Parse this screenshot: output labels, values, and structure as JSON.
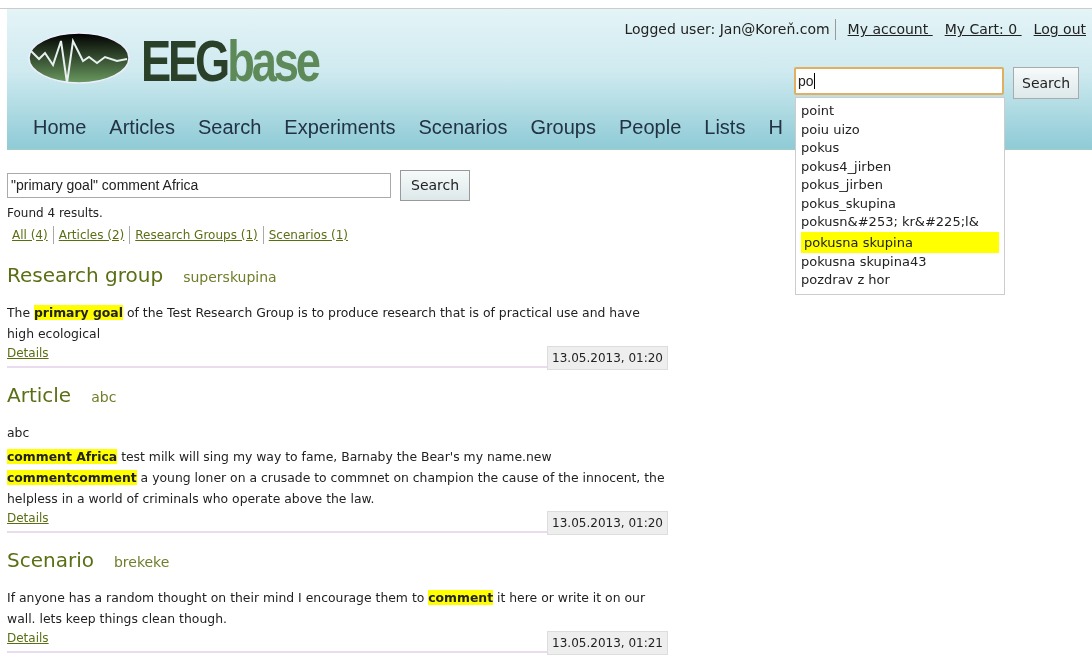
{
  "logo": {
    "dark": "EEG",
    "light": "base"
  },
  "user_bar": {
    "logged_user": "Logged user: Jan@Koreň.com",
    "links": [
      "My account ",
      "My Cart: 0 ",
      "Log out"
    ]
  },
  "header_search": {
    "value": "po",
    "button": "Search",
    "focused": true
  },
  "autocomplete": [
    {
      "label": "point",
      "selected": false
    },
    {
      "label": "poiu uizo",
      "selected": false
    },
    {
      "label": "pokus",
      "selected": false
    },
    {
      "label": "pokus4_jirben",
      "selected": false
    },
    {
      "label": "pokus_jirben",
      "selected": false
    },
    {
      "label": "pokus_skupina",
      "selected": false
    },
    {
      "label": "pokusn&#253; kr&#225;l&",
      "selected": false
    },
    {
      "label": "pokusna skupina",
      "selected": true
    },
    {
      "label": "pokusna skupina43",
      "selected": false
    },
    {
      "label": "pozdrav z hor",
      "selected": false
    }
  ],
  "nav": [
    "Home",
    "Articles",
    "Search",
    "Experiments",
    "Scenarios",
    "Groups",
    "People",
    "Lists",
    "H"
  ],
  "search": {
    "value": "\"primary goal\" comment Africa",
    "button": "Search"
  },
  "found": "Found 4 results.",
  "filters": [
    "All (4)",
    "Articles (2)",
    "Research Groups (1)",
    "Scenarios (1)"
  ],
  "results": [
    {
      "type": "Research group",
      "title": "superskupina",
      "paragraphs": [
        "The **primary goal** of the Test Research Group is to produce research that is of practical use and have high ecological"
      ],
      "details": "Details",
      "date": "13.05.2013, 01:20"
    },
    {
      "type": "Article",
      "title": "abc",
      "paragraphs": [
        "abc",
        "**comment Africa** test milk will sing my way to fame, Barnaby the Bear's my name.new **commentcomment** a young loner on a crusade to commnet on champion the cause of the innocent, the helpless in a world of criminals who operate above the law."
      ],
      "details": "Details",
      "date": "13.05.2013, 01:20"
    },
    {
      "type": "Scenario",
      "title": "brekeke",
      "paragraphs": [
        "If anyone has a random thought on their mind I encourage them to **comment** it here or write it on our wall. lets keep things clean though."
      ],
      "details": "Details",
      "date": "13.05.2013, 01:21"
    }
  ]
}
